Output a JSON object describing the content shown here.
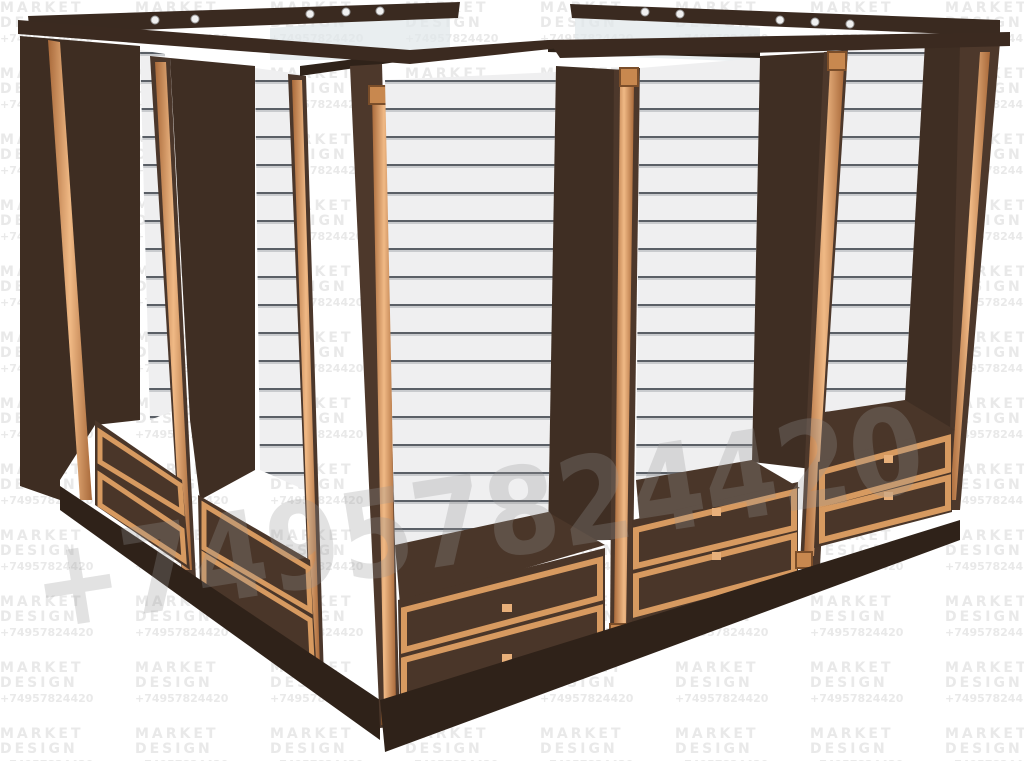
{
  "watermark": {
    "line1": "MARKET",
    "line2": "DESIGN",
    "line3": "+74957824420",
    "big_text": "+74957824420"
  },
  "colors": {
    "wood_dark": "#3d2c22",
    "wood_mid": "#4c372b",
    "wood_light": "#5b4333",
    "brass": "#c8884f",
    "brass_light": "#e8b07a",
    "slat_panel": "#eeeeef",
    "slat_line": "#555a60"
  }
}
